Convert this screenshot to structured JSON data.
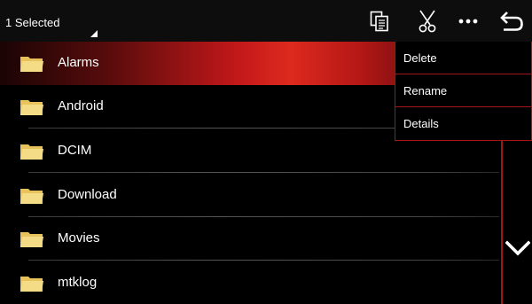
{
  "toolbar": {
    "selection_label": "1 Selected",
    "icons": [
      "copy-icon",
      "scissors-icon",
      "more-icon",
      "back-icon"
    ]
  },
  "files": [
    {
      "name": "Alarms",
      "selected": true
    },
    {
      "name": "Android",
      "selected": false
    },
    {
      "name": "DCIM",
      "selected": false
    },
    {
      "name": "Download",
      "selected": false
    },
    {
      "name": "Movies",
      "selected": false
    },
    {
      "name": "mtklog",
      "selected": false
    }
  ],
  "context_menu": {
    "items": [
      "Delete",
      "Rename",
      "Details"
    ]
  },
  "colors": {
    "accent": "#a3151a",
    "selected_row": "#dd2a1e",
    "folder": "#f4dc86",
    "background": "#000000"
  }
}
